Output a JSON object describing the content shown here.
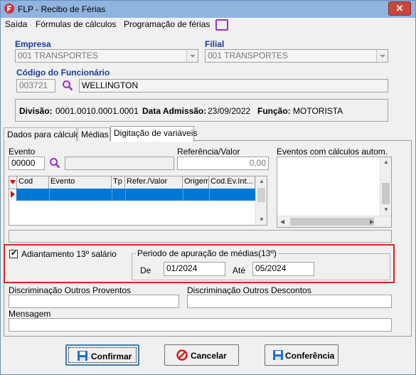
{
  "window": {
    "title": "FLP - Recibo de Férias",
    "close_label": "✕"
  },
  "menu": {
    "items": [
      "Saída",
      "Fórmulas de cálculos",
      "Programação de férias"
    ]
  },
  "header": {
    "empresa_label": "Empresa",
    "empresa_value": "001 TRANSPORTES",
    "filial_label": "Filial",
    "filial_value": "001 TRANSPORTES",
    "codigo_label": "Código do Funcionário",
    "codigo_value": "003721",
    "nome_value": "WELLINGTON"
  },
  "info": {
    "divisao_label": "Divisão:",
    "divisao_value": "0001.0010.0001.0001",
    "admissao_label": "Data Admissão:",
    "admissao_value": "23/09/2022",
    "funcao_label": "Função:",
    "funcao_value": "MOTORISTA"
  },
  "tabs": [
    "Dados para cálculo",
    "Médias",
    "Digitação de variáveis"
  ],
  "form": {
    "evento_label": "Evento",
    "evento_value": "00000",
    "referencia_label": "Referência/Valor",
    "referencia_value": "0,00",
    "eventos_calc_label": "Eventos com cálculos autom."
  },
  "grid": {
    "columns": [
      "Cod",
      "Evento",
      "Tp",
      "Refer./Valor",
      "Origem",
      "Cod.Ev.Int..."
    ]
  },
  "adiantamento": {
    "checkbox_label": "Adiantamento 13º salário",
    "checked": true,
    "periodo_label": "Periodo de apuração de médias(13º)",
    "de_label": "De",
    "de_value": "01/2024",
    "ate_label": "Até",
    "ate_value": "05/2024"
  },
  "bottom": {
    "proventos_label": "Discriminação Outros Proventos",
    "descontos_label": "Discriminação Outros Descontos",
    "mensagem_label": "Mensagem"
  },
  "buttons": {
    "confirmar": "Confirmar",
    "cancelar": "Cancelar",
    "conferencia": "Conferência"
  },
  "colors": {
    "accent_blue": "#1a3a9a",
    "highlight_red": "#e02020",
    "selection": "#0078d7",
    "search_purple": "#9b2fc9"
  }
}
